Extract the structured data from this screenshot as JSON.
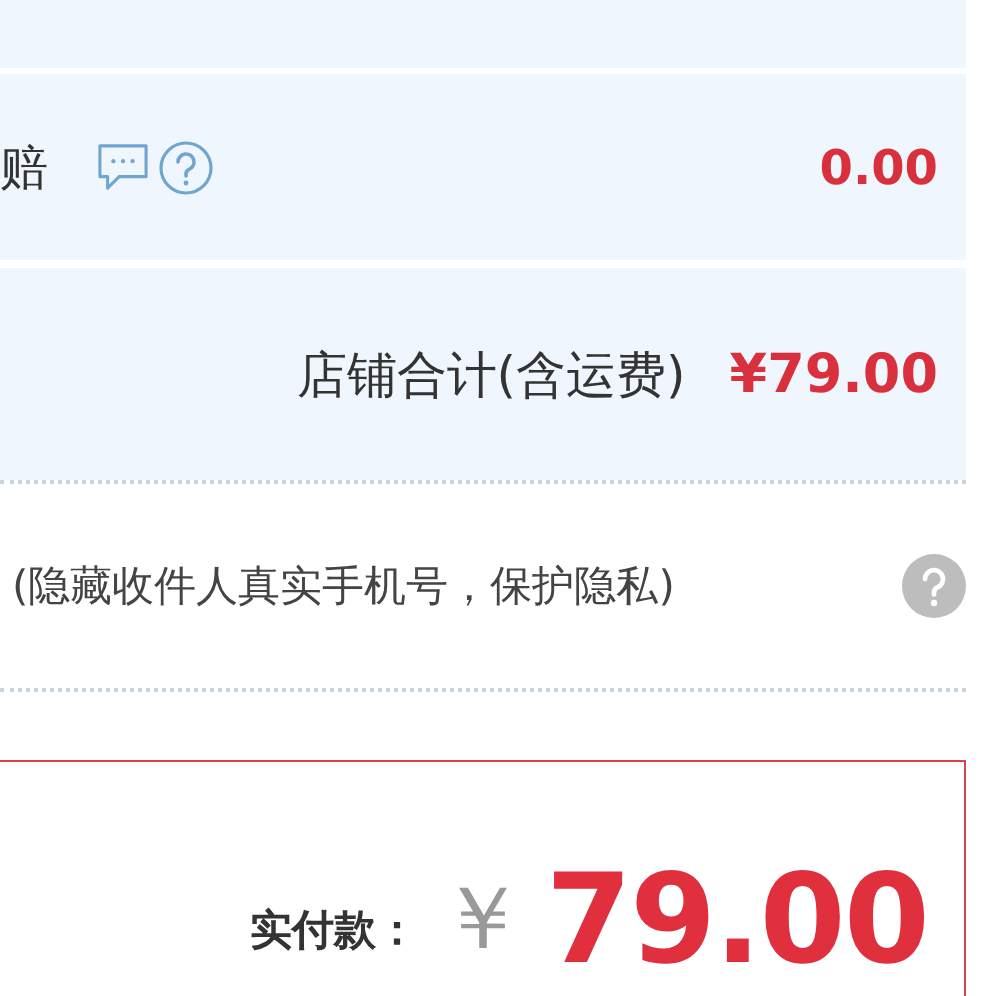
{
  "fee_row": {
    "label": "赔",
    "amount": "0.00"
  },
  "store_total": {
    "label": "店铺合计(含运费)",
    "amount": "¥79.00"
  },
  "privacy": {
    "text": "(隐藏收件人真实手机号，保护隐私)"
  },
  "payment": {
    "label": "实付款：",
    "currency": "￥",
    "amount": "79.00"
  }
}
